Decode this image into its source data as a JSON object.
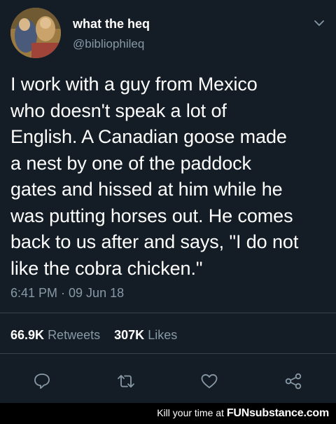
{
  "tweet": {
    "display_name": "what the heq",
    "handle": "@bibliophileq",
    "text": "I work with a guy from Mexico\nwho doesn't speak a lot of\nEnglish. A Canadian goose made\na nest by one of the paddock\ngates and hissed at him while he\nwas putting horses out. He comes\nback to us after and says, \"I do not\nlike the cobra chicken.\"",
    "timestamp": "6:41 PM · 09 Jun 18",
    "retweets_count": "66.9K",
    "retweets_label": "Retweets",
    "likes_count": "307K",
    "likes_label": "Likes"
  },
  "icons": {
    "menu": "chevron-down-icon",
    "reply": "reply-icon",
    "retweet": "retweet-icon",
    "like": "heart-icon",
    "share": "share-icon"
  },
  "footer": {
    "caption": "Kill your time at",
    "brand_fun": "FUN",
    "brand_rest": "substance.com"
  },
  "colors": {
    "background": "#141d26",
    "secondary_text": "#8899a6",
    "divider": "#38444d",
    "footer_bg": "#000000"
  }
}
